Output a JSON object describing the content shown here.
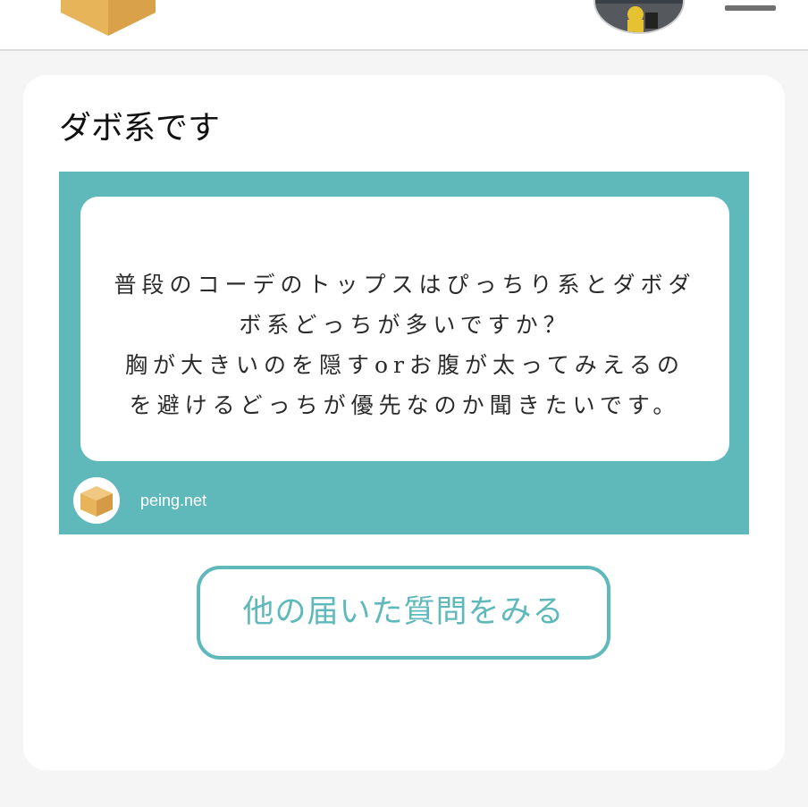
{
  "header": {
    "logo_icon": "cardboard-box-logo-icon",
    "user_avatar_icon": "user-avatar-photo",
    "menu_icon": "hamburger-menu-icon"
  },
  "answer": {
    "text": "ダボ系です"
  },
  "question_card": {
    "lines": [
      "普段のコーデのトップスはぴっちり系とダボダ",
      "ボ系どっちが多いですか？",
      "胸が大きいのを隠すorお腹が太ってみえるの",
      "を避けるどっちが優先なのか聞きたいです。"
    ],
    "site": "peing.net",
    "site_icon": "peing-box-icon"
  },
  "more_button": {
    "label": "他の届いた質問をみる"
  },
  "colors": {
    "accent": "#5fb8ba",
    "box": "#e8b45a",
    "page_bg": "#f5f5f5"
  }
}
